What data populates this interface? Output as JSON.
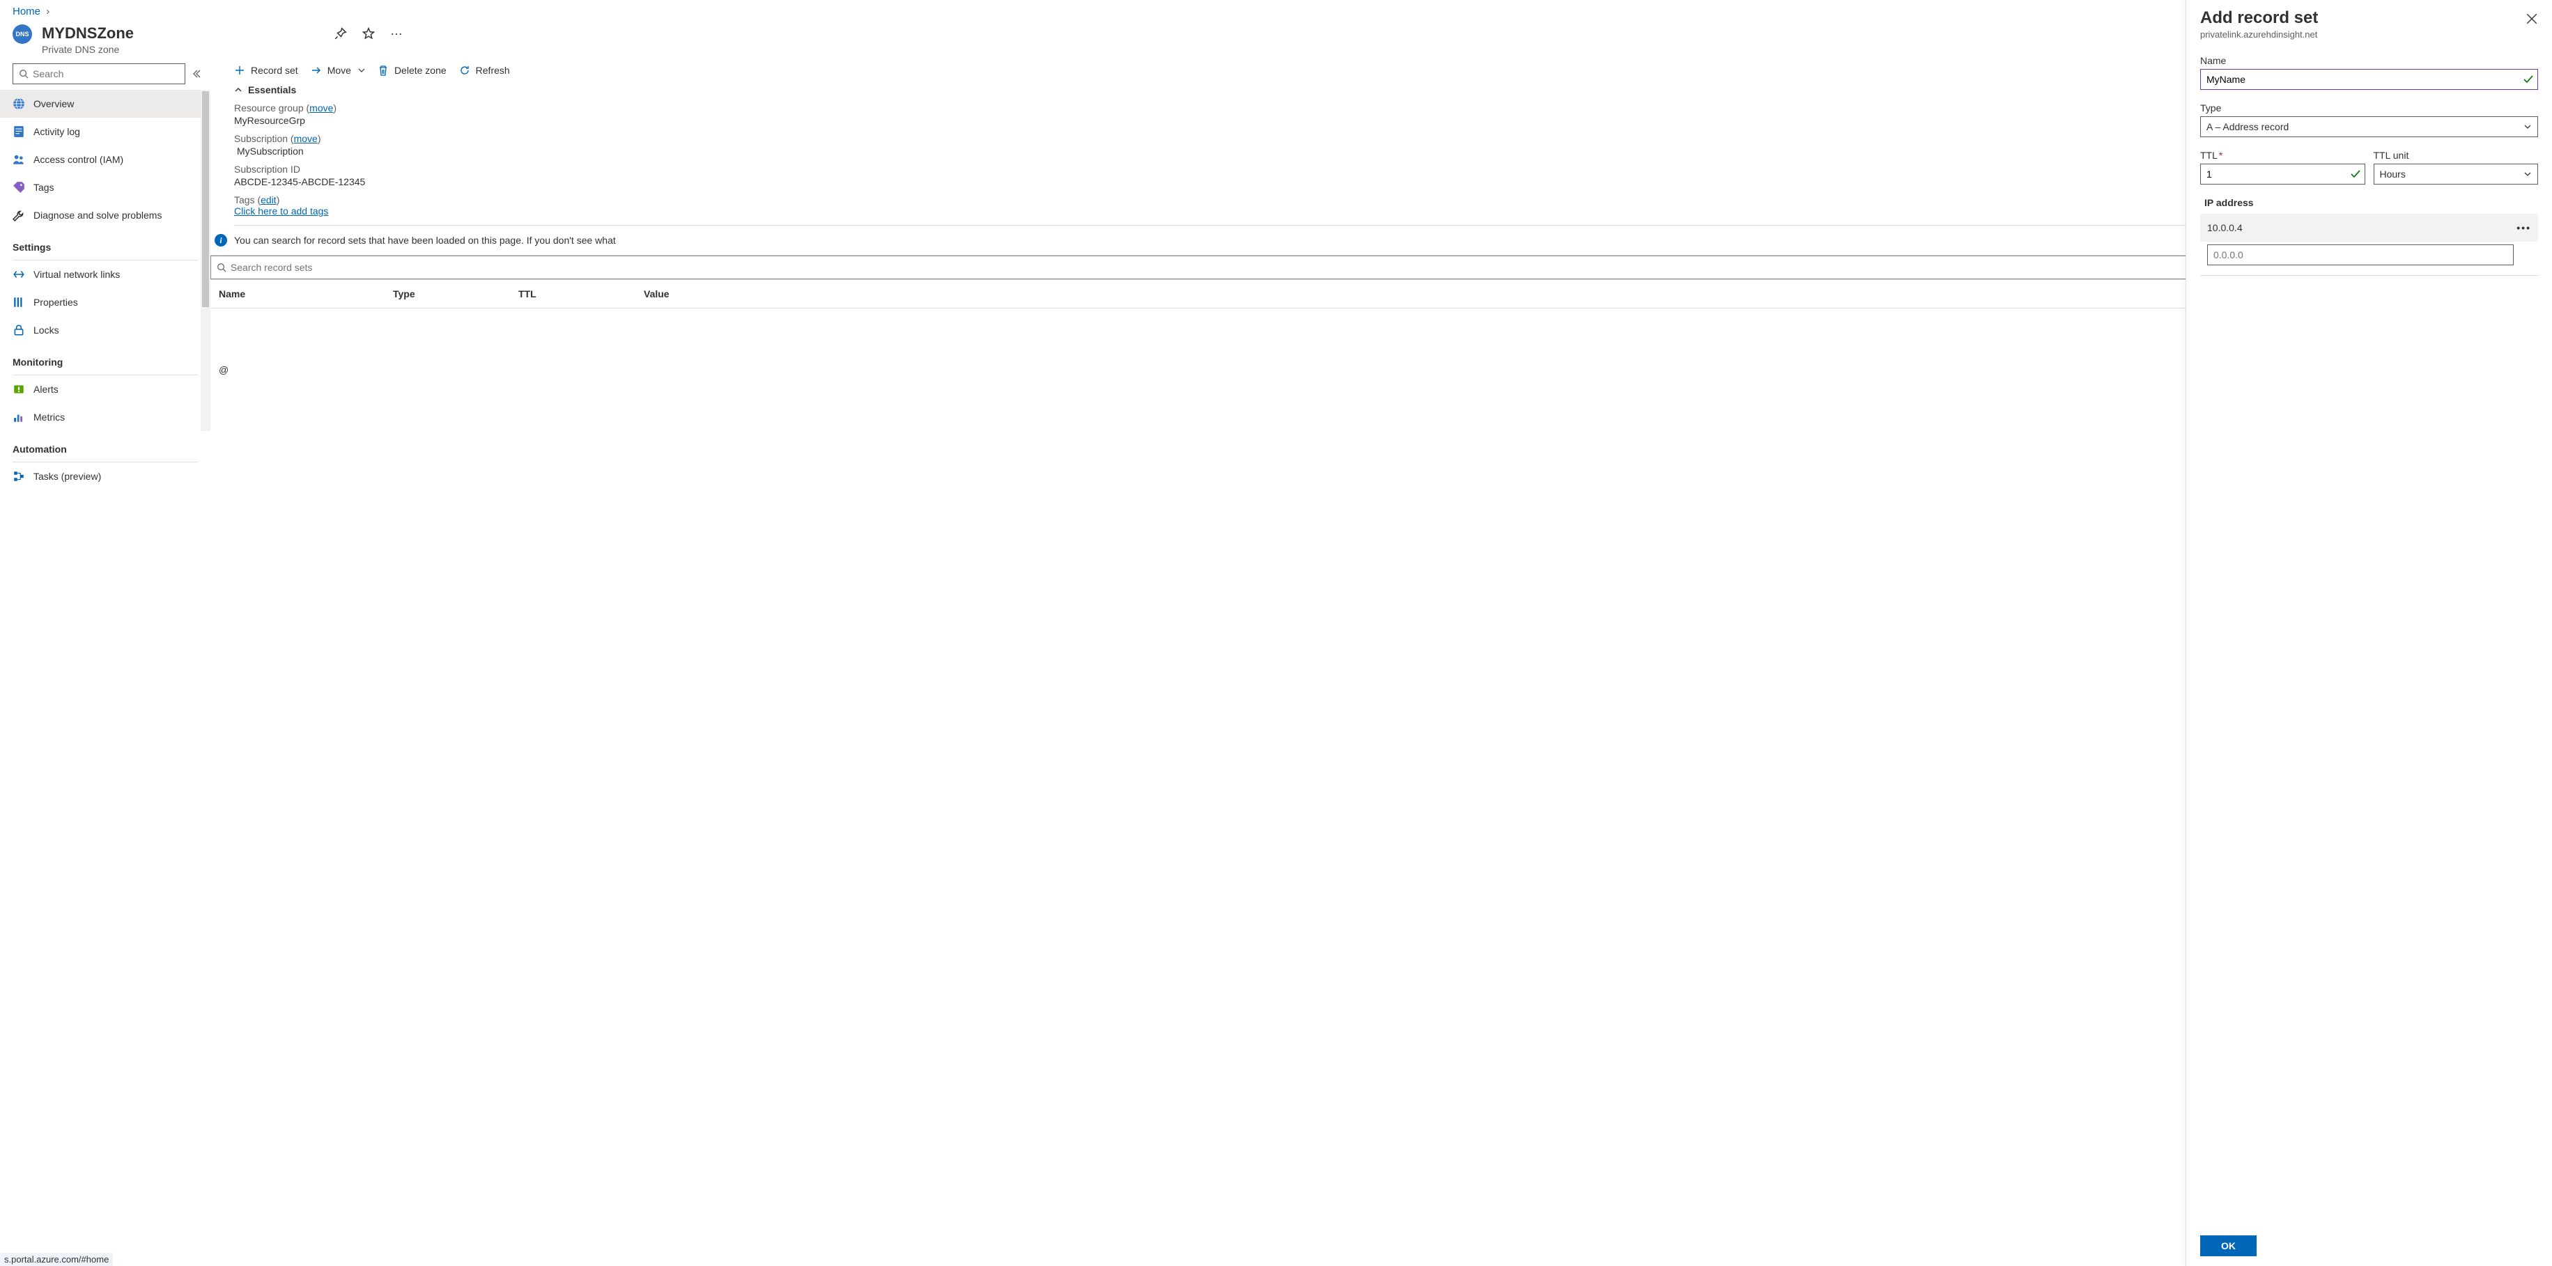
{
  "breadcrumb": {
    "home": "Home"
  },
  "header": {
    "title": "MYDNSZone",
    "subtitle": "Private DNS zone",
    "icon_text": "DNS"
  },
  "sidebar": {
    "search_placeholder": "Search",
    "items_top": [
      {
        "label": "Overview",
        "icon": "globe",
        "selected": true
      },
      {
        "label": "Activity log",
        "icon": "log"
      },
      {
        "label": "Access control (IAM)",
        "icon": "people"
      },
      {
        "label": "Tags",
        "icon": "tag"
      },
      {
        "label": "Diagnose and solve problems",
        "icon": "wrench"
      }
    ],
    "group_settings": "Settings",
    "items_settings": [
      {
        "label": "Virtual network links",
        "icon": "vnet"
      },
      {
        "label": "Properties",
        "icon": "props"
      },
      {
        "label": "Locks",
        "icon": "lock"
      }
    ],
    "group_monitoring": "Monitoring",
    "items_monitoring": [
      {
        "label": "Alerts",
        "icon": "alert"
      },
      {
        "label": "Metrics",
        "icon": "metrics"
      }
    ],
    "group_automation": "Automation",
    "items_automation": [
      {
        "label": "Tasks (preview)",
        "icon": "tasks"
      }
    ]
  },
  "toolbar": {
    "record_set": "Record set",
    "move": "Move",
    "delete_zone": "Delete zone",
    "refresh": "Refresh"
  },
  "essentials": {
    "title": "Essentials",
    "resource_group_label": "Resource group (",
    "resource_group_move": "move",
    "resource_group_close": ")",
    "resource_group_value": "MyResourceGrp",
    "subscription_label": "Subscription (",
    "subscription_move": "move",
    "subscription_close": ")",
    "subscription_value": "MySubscription",
    "subscription_id_label": "Subscription ID",
    "subscription_id_value": "ABCDE-12345-ABCDE-12345",
    "tags_label": "Tags (",
    "tags_edit": "edit",
    "tags_close": ")",
    "tags_link": "Click here to add tags"
  },
  "info_message": "You can search for record sets that have been loaded on this page. If you don't see what",
  "records": {
    "search_placeholder": "Search record sets",
    "col_name": "Name",
    "col_type": "Type",
    "col_ttl": "TTL",
    "col_value": "Value",
    "row_at": "@"
  },
  "panel": {
    "title": "Add record set",
    "subtitle": "privatelink.azurehdinsight.net",
    "name_label": "Name",
    "name_value": "MyName",
    "type_label": "Type",
    "type_value": "A – Address record",
    "ttl_label": "TTL",
    "ttl_value": "1",
    "ttl_unit_label": "TTL unit",
    "ttl_unit_value": "Hours",
    "ip_label": "IP address",
    "ip_existing": "10.0.0.4",
    "ip_placeholder": "0.0.0.0",
    "ok": "OK"
  },
  "status_bar": "s.portal.azure.com/#home"
}
